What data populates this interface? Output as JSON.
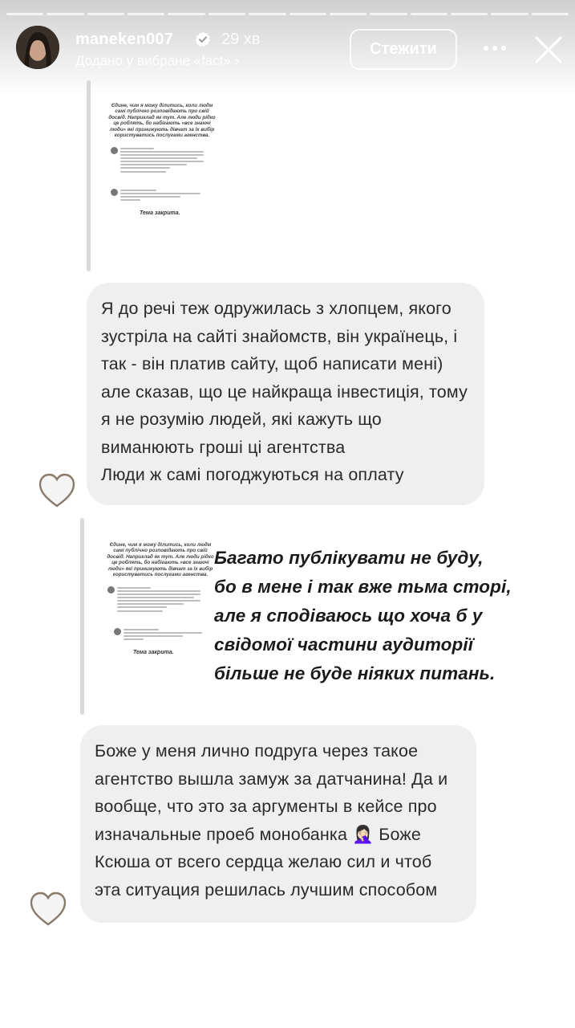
{
  "header": {
    "username": "maneken007",
    "time": "29 хв",
    "favorites_text": "Додано у вибране «fact» ›",
    "follow_label": "Стежити",
    "more_icon": "more-horizontal-icon",
    "close_icon": "close-icon"
  },
  "progress": {
    "segments": 14
  },
  "screenshot": {
    "question": "Єдине, чим я можу ділитись, коли людм самі публічно розповідають про свій досвід. Наприклад як тут. Але люди рідко це роблять, бо набігають «все знаючі люди» які принижують дівчат за їх вибір користуватись послугами агенства.",
    "ending": "Тема закрита."
  },
  "messages": [
    {
      "text": "Я до речі теж одружилась з хлопцем, якого зустріла на сайті знайомств, він українець, і так - він платив сайту, щоб написати мені) але сказав, що це найкраща інвестиція, тому я не розумію людей, які кажуть що виманюють гроші ці агентства\nЛюди ж самі погоджуються на оплату"
    },
    {
      "text": "Боже у меня лично подруга через такое агентство вышла замуж за датчанина! Да и вообще, что это за аргументы в кейсе про изначальные проеб монобанка 🤦🏻‍♀️ Боже Ксюша от всего сердца желаю сил и чтоб эта ситуация решилась лучшим способом"
    }
  ],
  "caption": "Багато публікувати не буду,\nбо в мене і так вже тьма сторі,\nале я сподіваюсь що хоча б у\nсвідомої частини аудиторії\nбільше не буде ніяких питань.",
  "colors": {
    "bubble": "#efefef",
    "quote_bar": "#d9d9d9",
    "text": "#2a2a2a"
  }
}
